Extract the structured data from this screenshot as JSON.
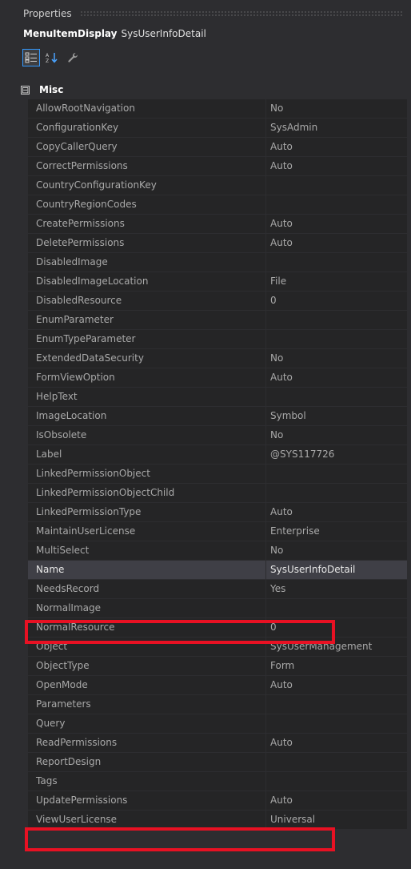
{
  "panel": {
    "title": "Properties"
  },
  "object": {
    "kind": "MenuItemDisplay",
    "name": "SysUserInfoDetail"
  },
  "toolbar": {
    "categorized_icon": "categorized-icon",
    "alphabetical_icon": "alphabetical-sort-icon",
    "wrench_icon": "wrench-icon"
  },
  "category": {
    "toggle": "⊟",
    "name": "Misc"
  },
  "properties": [
    {
      "name": "AllowRootNavigation",
      "value": "No"
    },
    {
      "name": "ConfigurationKey",
      "value": "SysAdmin"
    },
    {
      "name": "CopyCallerQuery",
      "value": "Auto"
    },
    {
      "name": "CorrectPermissions",
      "value": "Auto"
    },
    {
      "name": "CountryConfigurationKey",
      "value": ""
    },
    {
      "name": "CountryRegionCodes",
      "value": ""
    },
    {
      "name": "CreatePermissions",
      "value": "Auto"
    },
    {
      "name": "DeletePermissions",
      "value": "Auto"
    },
    {
      "name": "DisabledImage",
      "value": ""
    },
    {
      "name": "DisabledImageLocation",
      "value": "File"
    },
    {
      "name": "DisabledResource",
      "value": "0"
    },
    {
      "name": "EnumParameter",
      "value": ""
    },
    {
      "name": "EnumTypeParameter",
      "value": ""
    },
    {
      "name": "ExtendedDataSecurity",
      "value": "No"
    },
    {
      "name": "FormViewOption",
      "value": "Auto"
    },
    {
      "name": "HelpText",
      "value": ""
    },
    {
      "name": "ImageLocation",
      "value": "Symbol"
    },
    {
      "name": "IsObsolete",
      "value": "No"
    },
    {
      "name": "Label",
      "value": "@SYS117726"
    },
    {
      "name": "LinkedPermissionObject",
      "value": ""
    },
    {
      "name": "LinkedPermissionObjectChild",
      "value": ""
    },
    {
      "name": "LinkedPermissionType",
      "value": "Auto"
    },
    {
      "name": "MaintainUserLicense",
      "value": "Enterprise"
    },
    {
      "name": "MultiSelect",
      "value": "No"
    },
    {
      "name": "Name",
      "value": "SysUserInfoDetail"
    },
    {
      "name": "NeedsRecord",
      "value": "Yes"
    },
    {
      "name": "NormalImage",
      "value": ""
    },
    {
      "name": "NormalResource",
      "value": "0"
    },
    {
      "name": "Object",
      "value": "SysUserManagement"
    },
    {
      "name": "ObjectType",
      "value": "Form"
    },
    {
      "name": "OpenMode",
      "value": "Auto"
    },
    {
      "name": "Parameters",
      "value": ""
    },
    {
      "name": "Query",
      "value": ""
    },
    {
      "name": "ReadPermissions",
      "value": "Auto"
    },
    {
      "name": "ReportDesign",
      "value": ""
    },
    {
      "name": "Tags",
      "value": ""
    },
    {
      "name": "UpdatePermissions",
      "value": "Auto"
    },
    {
      "name": "ViewUserLicense",
      "value": "Universal"
    }
  ],
  "colors": {
    "highlight_box": "#e81123",
    "selected_row": "#3f3f46",
    "panel_bg": "#2d2d30",
    "grid_bg": "#252526"
  }
}
